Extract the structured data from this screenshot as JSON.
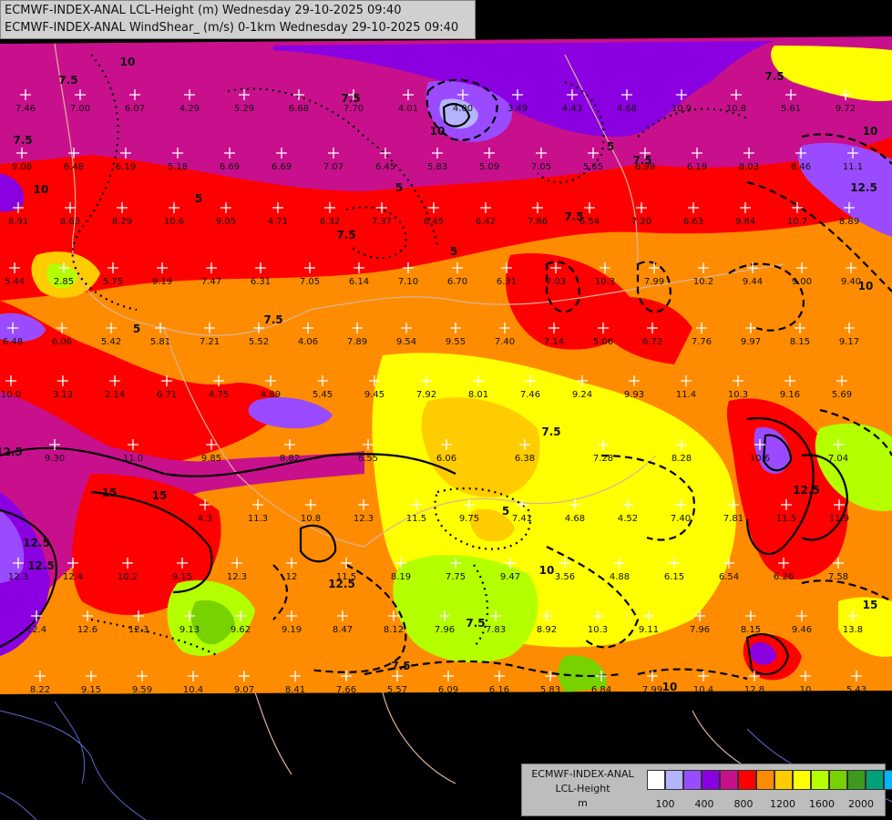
{
  "title": {
    "line1": "ECMWF-INDEX-ANAL LCL-Height (m) Wednesday 29-10-2025 09:40",
    "line2": "ECMWF-INDEX-ANAL WindShear_ (m/s) 0-1km Wednesday 29-10-2025 09:40"
  },
  "legend": {
    "title1": "ECMWF-INDEX-ANAL",
    "title2": "LCL-Height",
    "unit": "m",
    "colors": [
      "#ffffff",
      "#b4b4ff",
      "#9b4bff",
      "#8a00e0",
      "#c8108c",
      "#ff0000",
      "#ff8c00",
      "#ffcc00",
      "#ffff00",
      "#b4ff00",
      "#78d200",
      "#3c9b1e",
      "#00a078",
      "#00b4ff"
    ],
    "ticks": [
      "100",
      "400",
      "800",
      "1200",
      "1600",
      "2000"
    ]
  },
  "contour_labels": [
    "7.5",
    "10",
    "7.5",
    "5",
    "10",
    "7.5",
    "5",
    "7.5",
    "10",
    "5",
    "12.5",
    "7.5",
    "5",
    "7.5",
    "10",
    "12.5",
    "15",
    "12.5",
    "15",
    "12.5",
    "7.5",
    "5",
    "7.5",
    "12.5",
    "10",
    "7.5",
    "10",
    "5",
    "7.5",
    "12.5",
    "15",
    "7.5",
    "10"
  ],
  "station_values": [
    {
      "v": "7.46"
    },
    {
      "v": "7.00"
    },
    {
      "v": "6.07"
    },
    {
      "v": "4.29"
    },
    {
      "v": "5.29"
    },
    {
      "v": "6.68"
    },
    {
      "v": "7.70"
    },
    {
      "v": "4.01"
    },
    {
      "v": "4.00"
    },
    {
      "v": "3.49"
    },
    {
      "v": "4.43"
    },
    {
      "v": "4.68"
    },
    {
      "v": "10.9"
    },
    {
      "v": "10.8"
    },
    {
      "v": "5.61"
    },
    {
      "v": "9.72"
    },
    {
      "v": "9.08"
    },
    {
      "v": "6.48"
    },
    {
      "v": "6.19"
    },
    {
      "v": "5.18"
    },
    {
      "v": "6.69"
    },
    {
      "v": "6.69"
    },
    {
      "v": "7.07"
    },
    {
      "v": "6.45"
    },
    {
      "v": "5.83"
    },
    {
      "v": "5.09"
    },
    {
      "v": "7.05"
    },
    {
      "v": "5.65"
    },
    {
      "v": "6.99"
    },
    {
      "v": "6.19"
    },
    {
      "v": "8.03"
    },
    {
      "v": "8.46"
    },
    {
      "v": "11.1"
    },
    {
      "v": "8.91"
    },
    {
      "v": "8.63"
    },
    {
      "v": "8.29"
    },
    {
      "v": "10.6"
    },
    {
      "v": "9.05"
    },
    {
      "v": "4.71"
    },
    {
      "v": "6.32"
    },
    {
      "v": "7.37"
    },
    {
      "v": "6.45"
    },
    {
      "v": "6.42"
    },
    {
      "v": "7.86"
    },
    {
      "v": "6.54"
    },
    {
      "v": "7.20"
    },
    {
      "v": "6.63"
    },
    {
      "v": "9.84"
    },
    {
      "v": "10.7"
    },
    {
      "v": "8.89"
    },
    {
      "v": "5.44"
    },
    {
      "v": "2.85"
    },
    {
      "v": "5.75"
    },
    {
      "v": "9.19"
    },
    {
      "v": "7.47"
    },
    {
      "v": "6.31"
    },
    {
      "v": "7.05"
    },
    {
      "v": "6.14"
    },
    {
      "v": "7.10"
    },
    {
      "v": "6.70"
    },
    {
      "v": "6.31"
    },
    {
      "v": "7.03"
    },
    {
      "v": "10.3"
    },
    {
      "v": "7.99"
    },
    {
      "v": "10.2"
    },
    {
      "v": "9.44"
    },
    {
      "v": "9.00"
    },
    {
      "v": "9.40"
    },
    {
      "v": "6.48"
    },
    {
      "v": "6.06"
    },
    {
      "v": "5.42"
    },
    {
      "v": "5.81"
    },
    {
      "v": "7.21"
    },
    {
      "v": "5.52"
    },
    {
      "v": "4.06"
    },
    {
      "v": "7.89"
    },
    {
      "v": "9.54"
    },
    {
      "v": "9.55"
    },
    {
      "v": "7.40"
    },
    {
      "v": "7.14"
    },
    {
      "v": "5.06"
    },
    {
      "v": "6.72"
    },
    {
      "v": "7.76"
    },
    {
      "v": "9.97"
    },
    {
      "v": "8.15"
    },
    {
      "v": "9.17"
    },
    {
      "v": "10.0"
    },
    {
      "v": "3.13"
    },
    {
      "v": "2.14"
    },
    {
      "v": "6.71"
    },
    {
      "v": "4.75"
    },
    {
      "v": "4.89"
    },
    {
      "v": "5.45"
    },
    {
      "v": "9.45"
    },
    {
      "v": "7.92"
    },
    {
      "v": "8.01"
    },
    {
      "v": "7.46"
    },
    {
      "v": "9.24"
    },
    {
      "v": "9.93"
    },
    {
      "v": "11.4"
    },
    {
      "v": "10.3"
    },
    {
      "v": "9.16"
    },
    {
      "v": "5.69"
    },
    {
      "v": "9.30"
    },
    {
      "v": "11.0"
    },
    {
      "v": "9.85"
    },
    {
      "v": "8.82"
    },
    {
      "v": "6.55"
    },
    {
      "v": "6.06"
    },
    {
      "v": "6.38"
    },
    {
      "v": "7.28"
    },
    {
      "v": "8.28"
    },
    {
      "v": "10.6"
    },
    {
      "v": "7.04"
    },
    {
      "v": "4.3"
    },
    {
      "v": "11.3"
    },
    {
      "v": "10.8"
    },
    {
      "v": "12.3"
    },
    {
      "v": "11.5"
    },
    {
      "v": "9.75"
    },
    {
      "v": "7.41"
    },
    {
      "v": "4.68"
    },
    {
      "v": "4.52"
    },
    {
      "v": "7.40"
    },
    {
      "v": "7.81"
    },
    {
      "v": "11.5"
    },
    {
      "v": "11.9"
    },
    {
      "v": "12.3"
    },
    {
      "v": "12.4"
    },
    {
      "v": "10.2"
    },
    {
      "v": "9.15"
    },
    {
      "v": "12.3"
    },
    {
      "v": "12"
    },
    {
      "v": "11.5"
    },
    {
      "v": "8.19"
    },
    {
      "v": "7.75"
    },
    {
      "v": "9.47"
    },
    {
      "v": "3.56"
    },
    {
      "v": "4.88"
    },
    {
      "v": "6.15"
    },
    {
      "v": "6.54"
    },
    {
      "v": "6.26"
    },
    {
      "v": "7.58"
    },
    {
      "v": "12.4"
    },
    {
      "v": "12.6"
    },
    {
      "v": "12.3"
    },
    {
      "v": "9.13"
    },
    {
      "v": "9.62"
    },
    {
      "v": "9.19"
    },
    {
      "v": "8.47"
    },
    {
      "v": "8.12"
    },
    {
      "v": "7.96"
    },
    {
      "v": "7.83"
    },
    {
      "v": "8.92"
    },
    {
      "v": "10.3"
    },
    {
      "v": "9.11"
    },
    {
      "v": "7.96"
    },
    {
      "v": "8.15"
    },
    {
      "v": "9.46"
    },
    {
      "v": "13.8"
    },
    {
      "v": "8.22"
    },
    {
      "v": "9.15"
    },
    {
      "v": "9.59"
    },
    {
      "v": "10.4"
    },
    {
      "v": "9.07"
    },
    {
      "v": "8.41"
    },
    {
      "v": "7.66"
    },
    {
      "v": "5.57"
    },
    {
      "v": "6.09"
    },
    {
      "v": "6.16"
    },
    {
      "v": "5.83"
    },
    {
      "v": "6.84"
    },
    {
      "v": "7.99"
    },
    {
      "v": "10.4"
    },
    {
      "v": "12.8"
    },
    {
      "v": "10"
    },
    {
      "v": "5.43"
    }
  ]
}
